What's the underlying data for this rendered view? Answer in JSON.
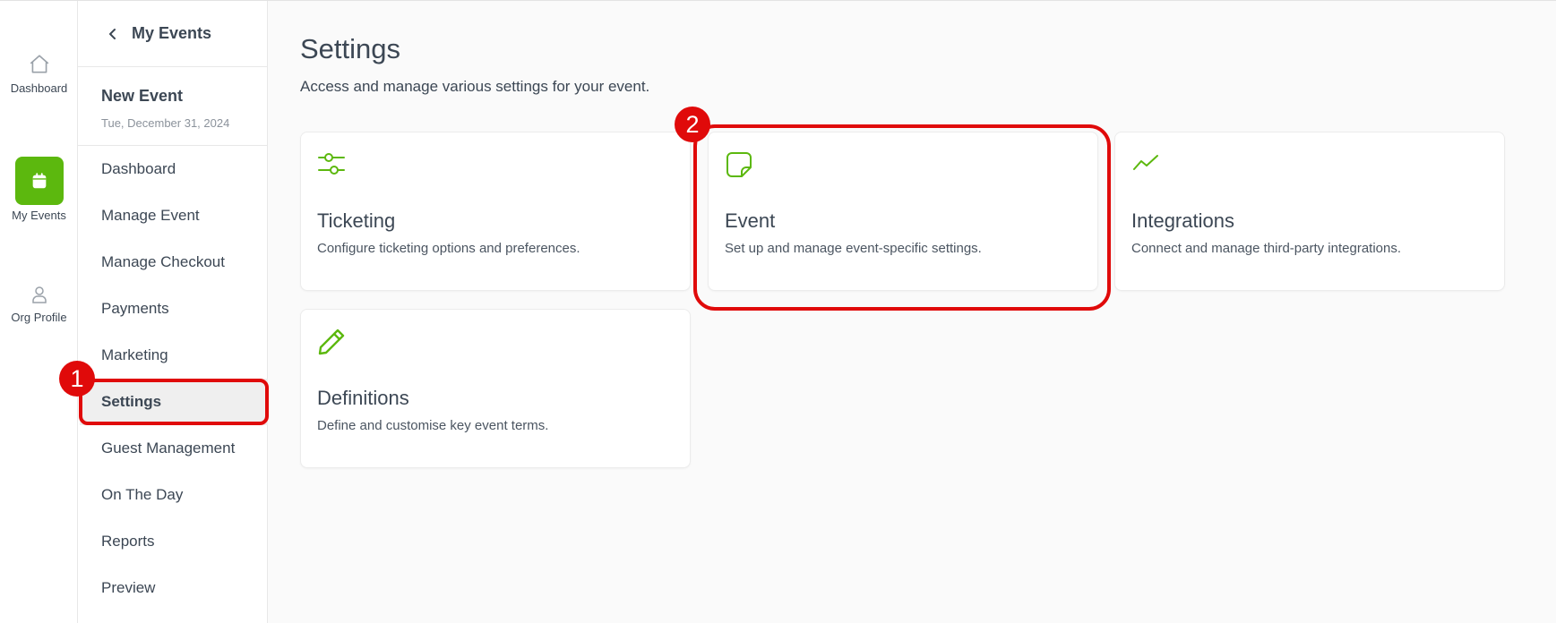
{
  "rail": {
    "items": [
      {
        "label": "Dashboard",
        "icon": "home-icon"
      },
      {
        "label": "My Events",
        "icon": "calendar-icon",
        "active": true
      },
      {
        "label": "Org Profile",
        "icon": "user-icon"
      }
    ],
    "accent": "#5cb80e"
  },
  "sidebar": {
    "back_label": "My Events",
    "event_name": "New Event",
    "event_date": "Tue, December 31, 2024",
    "items": [
      {
        "label": "Dashboard"
      },
      {
        "label": "Manage Event"
      },
      {
        "label": "Manage Checkout"
      },
      {
        "label": "Payments"
      },
      {
        "label": "Marketing"
      },
      {
        "label": "Settings",
        "active": true
      },
      {
        "label": "Guest Management"
      },
      {
        "label": "On The Day"
      },
      {
        "label": "Reports"
      },
      {
        "label": "Preview"
      }
    ]
  },
  "main": {
    "title": "Settings",
    "subtitle": "Access and manage various settings for your event.",
    "cards": [
      {
        "title": "Ticketing",
        "desc": "Configure ticketing options and preferences.",
        "icon": "sliders-icon"
      },
      {
        "title": "Event",
        "desc": "Set up and manage event-specific settings.",
        "icon": "sticky-note-icon"
      },
      {
        "title": "Integrations",
        "desc": "Connect and manage third-party integrations.",
        "icon": "trend-line-icon"
      },
      {
        "title": "Definitions",
        "desc": "Define and customise key event terms.",
        "icon": "pencil-icon"
      }
    ]
  },
  "annotations": {
    "badge_1": "1",
    "badge_2": "2",
    "color": "#e00a0a"
  }
}
